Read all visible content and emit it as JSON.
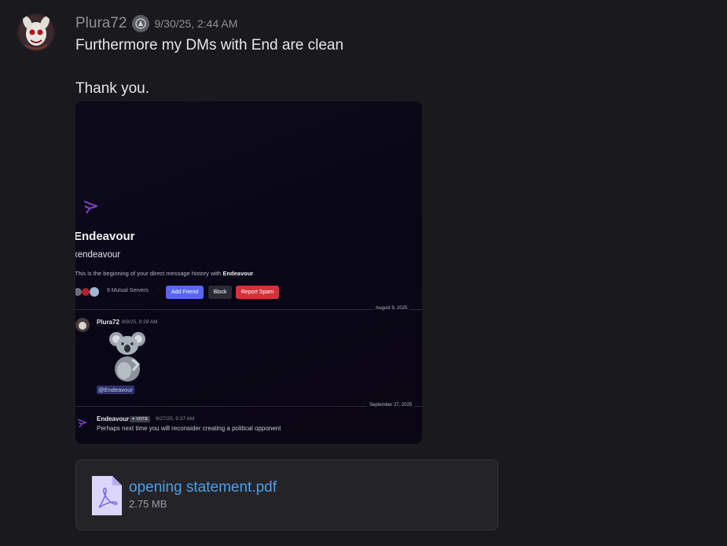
{
  "message": {
    "username": "Plura72",
    "timestamp": "9/30/25, 2:44 AM",
    "lines": [
      "Furthermore my DMs with End are clean",
      "Thank you."
    ]
  },
  "screenshot": {
    "profile_name": "Endeavour",
    "profile_handle": "xendeavour",
    "history_prefix": "This is the beginning of your direct message history with ",
    "history_name": "Endeavour",
    "mutual_servers": "9 Mutual Servers",
    "buttons": {
      "add_friend": "Add Friend",
      "block": "Block",
      "report_spam": "Report Spam"
    },
    "date_dividers": [
      "August 9, 2025",
      "September 27, 2025"
    ],
    "msg1": {
      "author": "Plura72",
      "time": "8/9/25, 9:28 AM",
      "mention": "@Endeavour"
    },
    "msg2": {
      "author": "Endeavour",
      "badge": "VOTE",
      "time": "9/27/25, 9:37 AM",
      "text": "Perhaps next time you will reconsider creating a political opponent"
    }
  },
  "attachment": {
    "file_name": "opening statement.pdf",
    "file_size": "2.75 MB",
    "icon": "pdf-file-icon"
  },
  "colors": {
    "background": "#1a1a1e",
    "link": "#4c9ee8",
    "accent_button": "#5865f2",
    "danger_button": "#d3323b"
  }
}
